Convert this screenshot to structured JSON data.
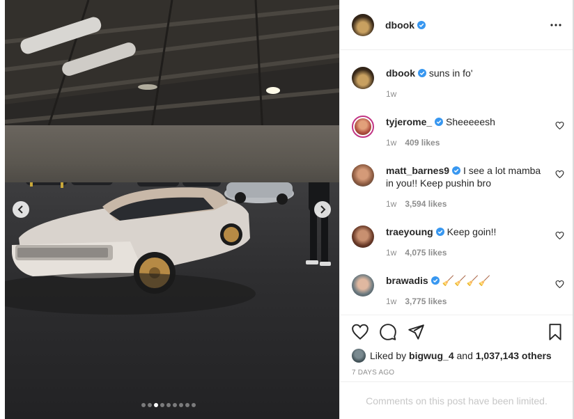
{
  "post": {
    "author": "dbook",
    "carousel": {
      "dot_count": 9,
      "active_index": 2
    }
  },
  "caption": {
    "username": "dbook",
    "text": "suns in fo'",
    "time": "1w"
  },
  "comments": [
    {
      "username": "tyjerome_",
      "text": "Sheeeeesh",
      "time": "1w",
      "likes": "409 likes"
    },
    {
      "username": "matt_barnes9",
      "text": "I see a lot mamba in you!! Keep pushin bro",
      "time": "1w",
      "likes": "3,594 likes"
    },
    {
      "username": "traeyoung",
      "text": "Keep goin!!",
      "time": "1w",
      "likes": "4,075 likes"
    },
    {
      "username": "brawadis",
      "text": "🧹🧹🧹🧹",
      "time": "1w",
      "likes": "3,775 likes"
    }
  ],
  "likes": {
    "prefix": "Liked by",
    "user": "bigwug_4",
    "and": "and",
    "others": "1,037,143 others"
  },
  "timestamp": "7 DAYS AGO",
  "comments_limited": "Comments on this post have been limited.",
  "colors": {
    "verified": "#3897f0",
    "muted": "#8e8e8e"
  }
}
